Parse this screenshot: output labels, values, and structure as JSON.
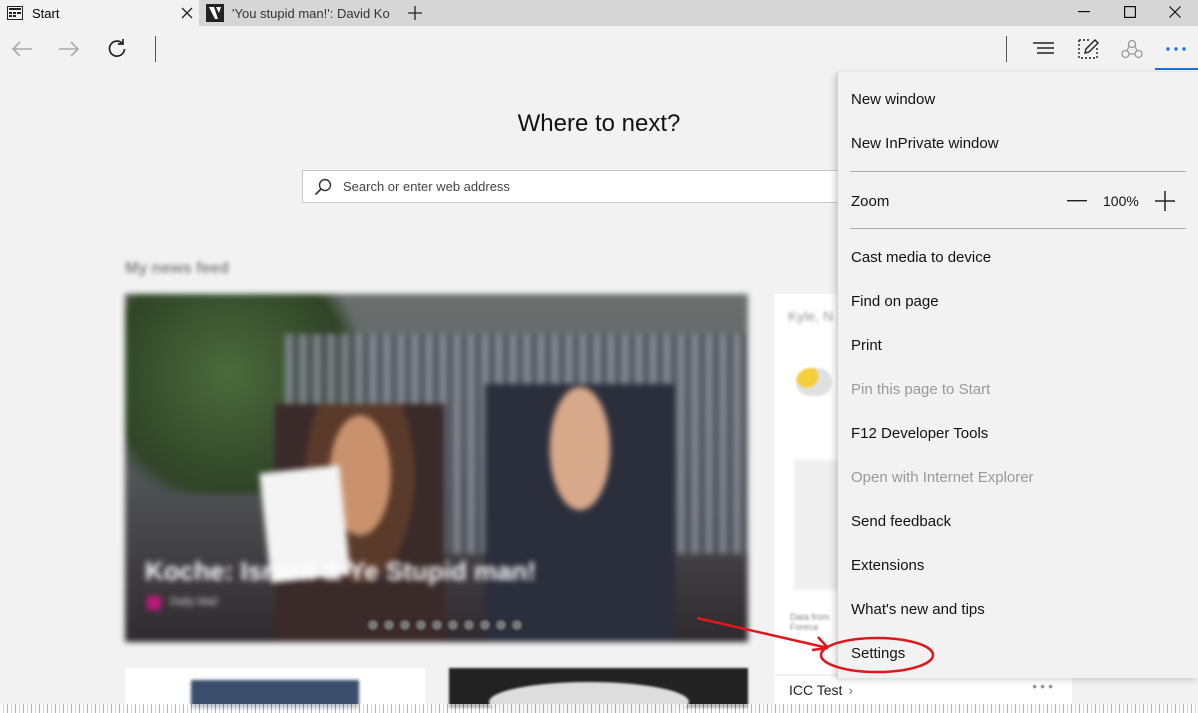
{
  "tabs": [
    {
      "title": "Start",
      "favicon": "start-page-icon",
      "active": true
    },
    {
      "title": "'You stupid man!': David Ko",
      "favicon": "site-favicon",
      "active": false
    }
  ],
  "toolbar": {
    "back": "back-arrow-icon",
    "forward": "forward-arrow-icon",
    "refresh": "refresh-icon",
    "hub": "hub-icon",
    "web_note": "web-note-icon",
    "share": "share-icon",
    "more": "more-icon"
  },
  "start_page": {
    "headline": "Where to next?",
    "search_placeholder": "Search or enter web address",
    "news_feed_title": "My news feed",
    "hero_caption": "Koche: Israeli & Ye Stupid man!",
    "hero_source": "Daily Mail",
    "weather_location": "Kyle, N",
    "weather_small": "Data from Foreca",
    "tile_label": "ICC Test"
  },
  "menu": {
    "new_window": "New window",
    "new_inprivate": "New InPrivate window",
    "zoom_label": "Zoom",
    "zoom_value": "100%",
    "cast": "Cast media to device",
    "find": "Find on page",
    "print": "Print",
    "pin": "Pin this page to Start",
    "devtools": "F12 Developer Tools",
    "open_ie": "Open with Internet Explorer",
    "feedback": "Send feedback",
    "extensions": "Extensions",
    "whats_new": "What's new and tips",
    "settings": "Settings"
  },
  "colors": {
    "accent": "#1a73d9",
    "annotation": "#e0161b"
  }
}
